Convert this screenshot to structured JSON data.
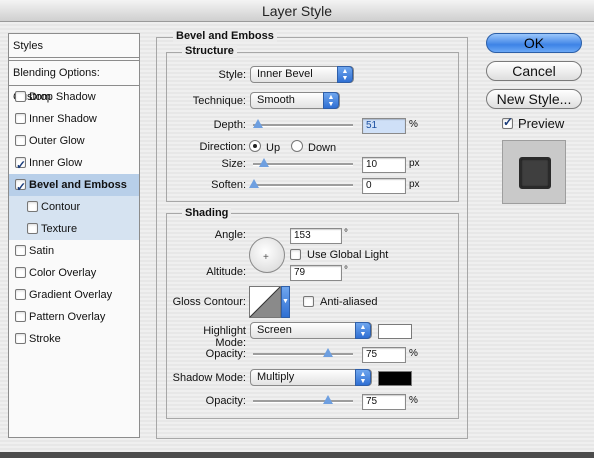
{
  "window": {
    "title": "Layer Style"
  },
  "sidebar": {
    "header": "Styles",
    "blending": "Blending Options: Custom",
    "items": [
      {
        "label": "Drop Shadow",
        "checked": false
      },
      {
        "label": "Inner Shadow",
        "checked": false
      },
      {
        "label": "Outer Glow",
        "checked": false
      },
      {
        "label": "Inner Glow",
        "checked": true
      },
      {
        "label": "Bevel and Emboss",
        "checked": true,
        "selected": true
      },
      {
        "label": "Contour",
        "checked": false,
        "sub": true
      },
      {
        "label": "Texture",
        "checked": false,
        "sub": true
      },
      {
        "label": "Satin",
        "checked": false
      },
      {
        "label": "Color Overlay",
        "checked": false
      },
      {
        "label": "Gradient Overlay",
        "checked": false
      },
      {
        "label": "Pattern Overlay",
        "checked": false
      },
      {
        "label": "Stroke",
        "checked": false
      }
    ]
  },
  "panel": {
    "title": "Bevel and Emboss",
    "structure": {
      "title": "Structure",
      "style_label": "Style:",
      "style_value": "Inner Bevel",
      "technique_label": "Technique:",
      "technique_value": "Smooth",
      "depth_label": "Depth:",
      "depth_value": "51",
      "depth_unit": "%",
      "direction_label": "Direction:",
      "dir_up": "Up",
      "dir_down": "Down",
      "size_label": "Size:",
      "size_value": "10",
      "size_unit": "px",
      "soften_label": "Soften:",
      "soften_value": "0",
      "soften_unit": "px"
    },
    "shading": {
      "title": "Shading",
      "angle_label": "Angle:",
      "angle_value": "153",
      "angle_unit": "°",
      "global_light": "Use Global Light",
      "altitude_label": "Altitude:",
      "altitude_value": "79",
      "altitude_unit": "°",
      "gloss_label": "Gloss Contour:",
      "anti_aliased": "Anti-aliased",
      "highlight_label": "Highlight Mode:",
      "highlight_value": "Screen",
      "highlight_color": "#ffffff",
      "h_opacity_label": "Opacity:",
      "h_opacity_value": "75",
      "h_opacity_unit": "%",
      "shadow_label": "Shadow Mode:",
      "shadow_value": "Multiply",
      "shadow_color": "#000000",
      "s_opacity_label": "Opacity:",
      "s_opacity_value": "75",
      "s_opacity_unit": "%"
    }
  },
  "buttons": {
    "ok": "OK",
    "cancel": "Cancel",
    "new_style": "New Style...",
    "preview": "Preview",
    "preview_checked": true
  }
}
